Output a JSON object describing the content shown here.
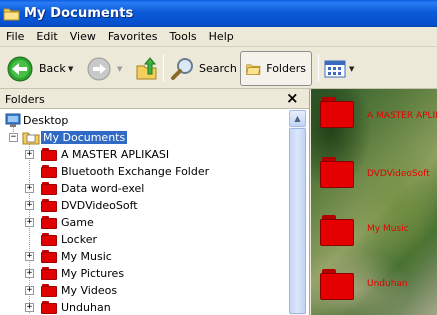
{
  "window": {
    "title": "My Documents"
  },
  "menu": [
    "File",
    "Edit",
    "View",
    "Favorites",
    "Tools",
    "Help"
  ],
  "toolbar": {
    "back": "Back",
    "search": "Search",
    "folders": "Folders"
  },
  "pane": {
    "title": "Folders",
    "close": "×"
  },
  "tree": {
    "desktop": "Desktop",
    "my_documents": "My Documents",
    "children": [
      "A MASTER APLIKASI",
      "Bluetooth Exchange Folder",
      "Data word-exel",
      "DVDVideoSoft",
      "Game",
      "Locker",
      "My Music",
      "My Pictures",
      "My Videos",
      "Unduhan"
    ]
  },
  "content": {
    "items": [
      "A MASTER APLIKASI",
      "DVDVideoSoft",
      "My Music",
      "Unduhan"
    ]
  },
  "colors": {
    "titlebar": "#0b5ad8",
    "selection": "#316ac5",
    "folder": "#e00000"
  }
}
